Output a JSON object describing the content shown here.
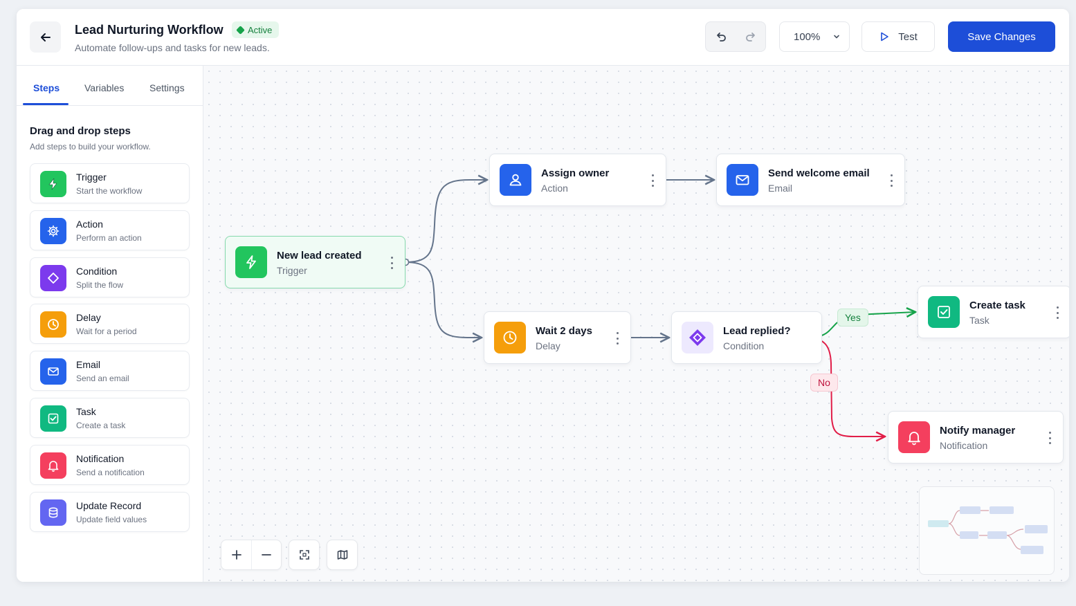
{
  "header": {
    "title": "Lead Nurturing Workflow",
    "status": "Active",
    "subtitle": "Automate follow-ups and tasks for new leads.",
    "zoom": "100%",
    "test_label": "Test",
    "save_label": "Save Changes"
  },
  "sidebar": {
    "tabs": [
      {
        "label": "Steps",
        "active": true
      },
      {
        "label": "Variables",
        "active": false
      },
      {
        "label": "Settings",
        "active": false
      }
    ],
    "panel_title": "Drag and drop steps",
    "panel_subtitle": "Add steps to build your workflow.",
    "steps": [
      {
        "name": "Trigger",
        "desc": "Start the workflow",
        "icon": "lightning-icon",
        "color": "#22c55e"
      },
      {
        "name": "Action",
        "desc": "Perform an action",
        "icon": "gear-icon",
        "color": "#2563eb"
      },
      {
        "name": "Condition",
        "desc": "Split the flow",
        "icon": "diamond-icon",
        "color": "#7c3aed"
      },
      {
        "name": "Delay",
        "desc": "Wait for a period",
        "icon": "clock-icon",
        "color": "#f59e0b"
      },
      {
        "name": "Email",
        "desc": "Send an email",
        "icon": "mail-icon",
        "color": "#2563eb"
      },
      {
        "name": "Task",
        "desc": "Create a task",
        "icon": "check-square-icon",
        "color": "#10b981"
      },
      {
        "name": "Notification",
        "desc": "Send a notification",
        "icon": "bell-icon",
        "color": "#f43f5e"
      },
      {
        "name": "Update Record",
        "desc": "Update field values",
        "icon": "database-icon",
        "color": "#6366f1"
      }
    ]
  },
  "canvas": {
    "nodes": {
      "new_lead": {
        "title": "New lead created",
        "type": "Trigger"
      },
      "assign_owner": {
        "title": "Assign owner",
        "type": "Action"
      },
      "send_welcome": {
        "title": "Send welcome email",
        "type": "Email"
      },
      "wait": {
        "title": "Wait 2 days",
        "type": "Delay"
      },
      "lead_replied": {
        "title": "Lead replied?",
        "type": "Condition"
      },
      "create_task": {
        "title": "Create task",
        "type": "Task"
      },
      "notify_manager": {
        "title": "Notify manager",
        "type": "Notification"
      }
    },
    "edge_labels": {
      "yes": "Yes",
      "no": "No"
    }
  },
  "colors": {
    "primary": "#1d4ed8",
    "success": "#16a34a",
    "danger": "#e11d48",
    "edge": "#64748b"
  }
}
